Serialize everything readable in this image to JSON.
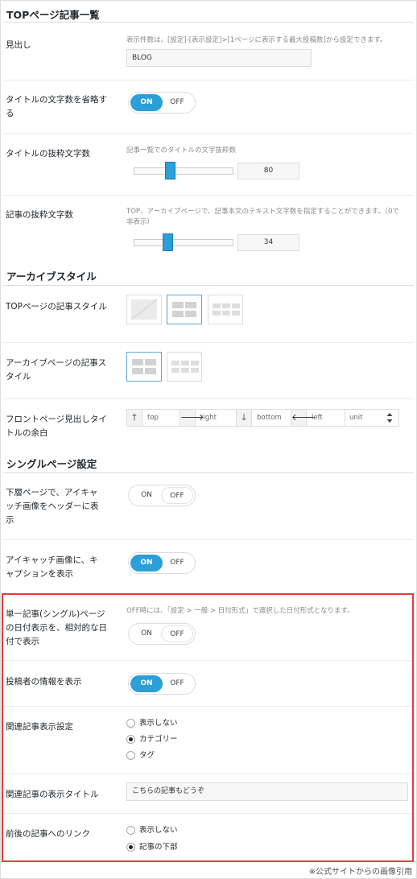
{
  "sections": {
    "top_list": "TOPページ記事一覧",
    "archive_style": "アーカイブスタイル",
    "single_page": "シングルページ設定"
  },
  "toggle": {
    "on": "ON",
    "off": "OFF"
  },
  "heading": {
    "label": "見出し",
    "description": "表示件数は、[設定]-[表示設定]>[1ページに表示する最大投稿数]から設定できます。",
    "value": "BLOG"
  },
  "title_omit": {
    "label": "タイトルの文字数を省略する",
    "state": "ON"
  },
  "title_excerpt": {
    "label": "タイトルの抜粋文字数",
    "description": "記事一覧でのタイトルの文字抜粋数",
    "value": "80"
  },
  "post_excerpt": {
    "label": "記事の抜粋文字数",
    "description": "TOP、アーカイブページで、記事本文のテキスト文字数を指定することができます。（0で非表示）",
    "value": "34"
  },
  "top_style": {
    "label": "TOPページの記事スタイル"
  },
  "archive_page_style": {
    "label": "アーカイブページの記事スタイル"
  },
  "front_margin": {
    "label": "フロントページ見出しタイトルの余白",
    "top": "top",
    "right": "right",
    "bottom": "bottom",
    "left": "left",
    "unit": "unit"
  },
  "eyecatch_header": {
    "label": "下層ページで、アイキャッチ画像をヘッダーに表示",
    "state": "OFF"
  },
  "eyecatch_caption": {
    "label": "アイキャッチ画像に、キャプションを表示",
    "state": "ON"
  },
  "relative_date": {
    "label": "単一記事(シングル)ページの日付表示を、相対的な日付で表示",
    "description": "OFF時には、「設定 > 一般 > 日付形式」で選択した日付形式となります。",
    "state": "OFF"
  },
  "author_info": {
    "label": "投稿者の情報を表示",
    "state": "ON"
  },
  "related_posts": {
    "label": "関連記事表示設定",
    "options": [
      "表示しない",
      "カテゴリー",
      "タグ"
    ],
    "selected": "カテゴリー"
  },
  "related_title": {
    "label": "関連記事の表示タイトル",
    "value": "こちらの記事もどうぞ"
  },
  "prev_next": {
    "label": "前後の記事へのリンク",
    "options": [
      "表示しない",
      "記事の下部"
    ],
    "selected": "記事の下部"
  },
  "colors": {
    "accent": "#2c9ed8",
    "highlight": "#e53b3b"
  },
  "caption": "※公式サイトからの画像引用"
}
